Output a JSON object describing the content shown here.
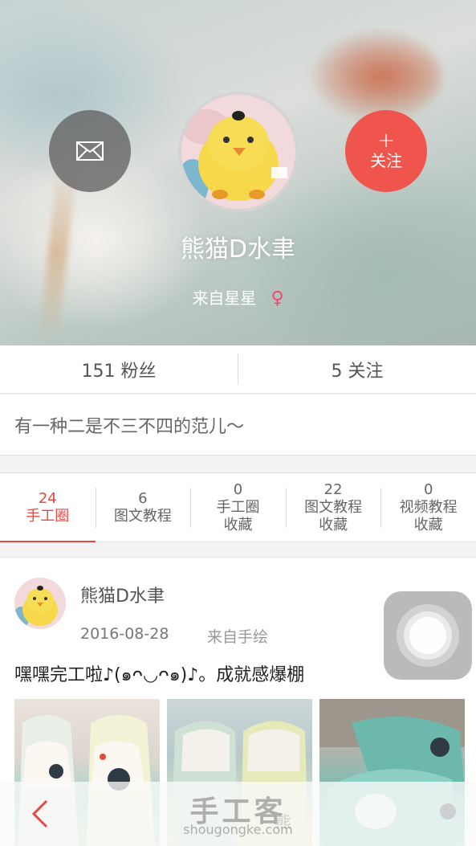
{
  "profile": {
    "username": "熊猫D水聿",
    "origin": "来自星星",
    "gender_symbol": "♀",
    "follow_label": "关注",
    "follow_plus": "+"
  },
  "stats": {
    "fans": "151 粉丝",
    "following": "5 关注"
  },
  "bio": "有一种二是不三不四的范儿～",
  "tabs": [
    {
      "count": "24",
      "line1": "手工圈",
      "line2": ""
    },
    {
      "count": "6",
      "line1": "图文教程",
      "line2": ""
    },
    {
      "count": "0",
      "line1": "手工圈",
      "line2": "收藏"
    },
    {
      "count": "22",
      "line1": "图文教程",
      "line2": "收藏"
    },
    {
      "count": "0",
      "line1": "视频教程",
      "line2": "收藏"
    }
  ],
  "post": {
    "author": "熊猫D水聿",
    "date": "2016-08-28",
    "source": "来自手绘",
    "text": "嘿嘿完工啦♪(๑ᴖ◡ᴖ๑)♪。成就感爆棚"
  },
  "footer": {
    "watermark_main": "手工客",
    "watermark_sub": "shougongke.com"
  },
  "colors": {
    "accent": "#f0554d",
    "tab_active": "#e24b42",
    "female": "#ee4a68"
  },
  "icons": [
    "mail-icon",
    "plus-icon",
    "female-icon",
    "back-icon",
    "assistive-touch-icon"
  ]
}
